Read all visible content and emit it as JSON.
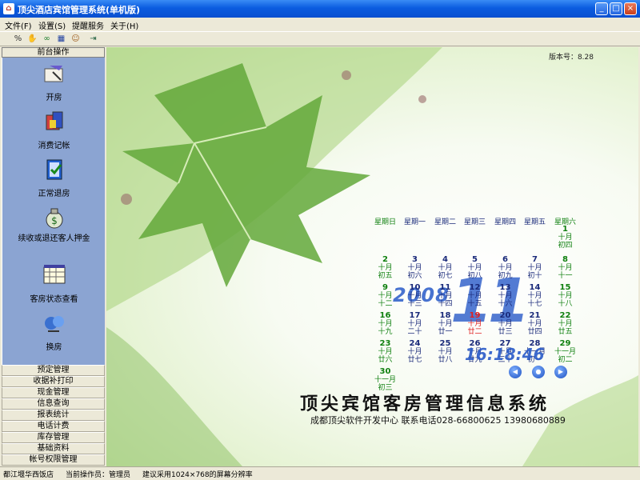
{
  "window": {
    "title": "顶尖酒店宾馆管理系统(单机版)"
  },
  "menu": [
    "文件(F)",
    "设置(S)",
    "提醒服务",
    "关于(H)"
  ],
  "toolbar_icons": [
    "percent-icon",
    "hand-icon",
    "link-icon",
    "grid-icon",
    "user-icon",
    "exit-icon"
  ],
  "left_panel": {
    "header": "前台操作",
    "items": [
      {
        "label": "开房",
        "icon": "open-room-icon"
      },
      {
        "label": "消费记帐",
        "icon": "consume-icon"
      },
      {
        "label": "正常退房",
        "icon": "checkout-icon"
      },
      {
        "label": "续收或退还客人押金",
        "icon": "deposit-icon"
      },
      {
        "label": "客房状态查看",
        "icon": "room-status-icon"
      },
      {
        "label": "换房",
        "icon": "change-room-icon"
      }
    ],
    "modules": [
      "预定管理",
      "收据补打印",
      "现金管理",
      "信息查询",
      "报表统计",
      "电话计费",
      "库存管理",
      "基础资料",
      "帐号权限管理"
    ]
  },
  "main": {
    "version": "版本号：8.28",
    "calendar": {
      "weekdays": [
        "星期日",
        "星期一",
        "星期二",
        "星期三",
        "星期四",
        "星期五",
        "星期六"
      ],
      "year": "2008",
      "month": "11",
      "time": "16:18:46",
      "today": 19,
      "rows": [
        [
          null,
          null,
          null,
          null,
          null,
          null,
          {
            "d": "1",
            "l1": "十月",
            "l2": "初四"
          }
        ],
        [
          {
            "d": "2",
            "l1": "十月",
            "l2": "初五"
          },
          {
            "d": "3",
            "l1": "十月",
            "l2": "初六"
          },
          {
            "d": "4",
            "l1": "十月",
            "l2": "初七"
          },
          {
            "d": "5",
            "l1": "十月",
            "l2": "初八"
          },
          {
            "d": "6",
            "l1": "十月",
            "l2": "初九"
          },
          {
            "d": "7",
            "l1": "十月",
            "l2": "初十"
          },
          {
            "d": "8",
            "l1": "十月",
            "l2": "十一"
          }
        ],
        [
          {
            "d": "9",
            "l1": "十月",
            "l2": "十二"
          },
          {
            "d": "10",
            "l1": "十月",
            "l2": "十三"
          },
          {
            "d": "11",
            "l1": "十月",
            "l2": "十四"
          },
          {
            "d": "12",
            "l1": "十月",
            "l2": "十五"
          },
          {
            "d": "13",
            "l1": "十月",
            "l2": "十六"
          },
          {
            "d": "14",
            "l1": "十月",
            "l2": "十七"
          },
          {
            "d": "15",
            "l1": "十月",
            "l2": "十八"
          }
        ],
        [
          {
            "d": "16",
            "l1": "十月",
            "l2": "十九"
          },
          {
            "d": "17",
            "l1": "十月",
            "l2": "二十"
          },
          {
            "d": "18",
            "l1": "十月",
            "l2": "廿一"
          },
          {
            "d": "19",
            "l1": "十月",
            "l2": "廿二"
          },
          {
            "d": "20",
            "l1": "十月",
            "l2": "廿三"
          },
          {
            "d": "21",
            "l1": "十月",
            "l2": "廿四"
          },
          {
            "d": "22",
            "l1": "十月",
            "l2": "廿五"
          }
        ],
        [
          {
            "d": "23",
            "l1": "十月",
            "l2": "廿六"
          },
          {
            "d": "24",
            "l1": "十月",
            "l2": "廿七"
          },
          {
            "d": "25",
            "l1": "十月",
            "l2": "廿八"
          },
          {
            "d": "26",
            "l1": "十月",
            "l2": "廿九"
          },
          {
            "d": "27",
            "l1": "十月",
            "l2": "三十"
          },
          {
            "d": "28",
            "l1": "十一月",
            "l2": "初一"
          },
          {
            "d": "29",
            "l1": "十一月",
            "l2": "初二"
          }
        ],
        [
          {
            "d": "30",
            "l1": "十一月",
            "l2": "初三"
          },
          null,
          null,
          null,
          null,
          null,
          null
        ]
      ]
    },
    "system_title": "顶尖宾馆客房管理信息系统",
    "company": "成都顶尖软件开发中心   联系电话028-66800625   13980680889"
  },
  "status": [
    "都江堰华西饭店",
    "当前操作员：管理员",
    "建议采用1024×768的屏幕分辨率"
  ]
}
